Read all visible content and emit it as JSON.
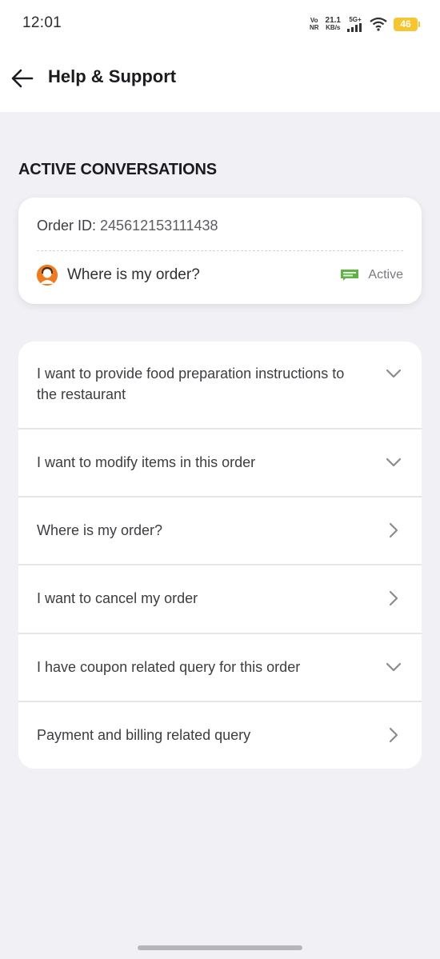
{
  "status_bar": {
    "time": "12:01",
    "vo": "Vo",
    "nr": "NR",
    "speed_value": "21.1",
    "speed_unit": "KB/s",
    "network": "5G+",
    "battery": "46"
  },
  "header": {
    "title": "Help & Support",
    "back_icon": "arrow-left-icon"
  },
  "active_conversations": {
    "section_title": "ACTIVE CONVERSATIONS",
    "order_label": "Order ID:",
    "order_id": "245612153111438",
    "topic": "Where is my order?",
    "status": "Active",
    "status_color": "#60b246",
    "avatar_color": "#f07a1e"
  },
  "menu": {
    "items": [
      {
        "label": "I want to provide food preparation instructions to the restaurant",
        "icon": "chevron-down-icon"
      },
      {
        "label": "I want to modify items in this order",
        "icon": "chevron-down-icon"
      },
      {
        "label": "Where is my order?",
        "icon": "chevron-right-icon"
      },
      {
        "label": "I want to cancel my order",
        "icon": "chevron-right-icon"
      },
      {
        "label": "I have coupon related query for this order",
        "icon": "chevron-down-icon"
      },
      {
        "label": "Payment and billing related query",
        "icon": "chevron-right-icon"
      }
    ]
  },
  "colors": {
    "background": "#f0f0f5",
    "card": "#ffffff",
    "text_dark": "#1b1b1f",
    "text_body": "#3d3d42",
    "battery": "#f6c630"
  }
}
